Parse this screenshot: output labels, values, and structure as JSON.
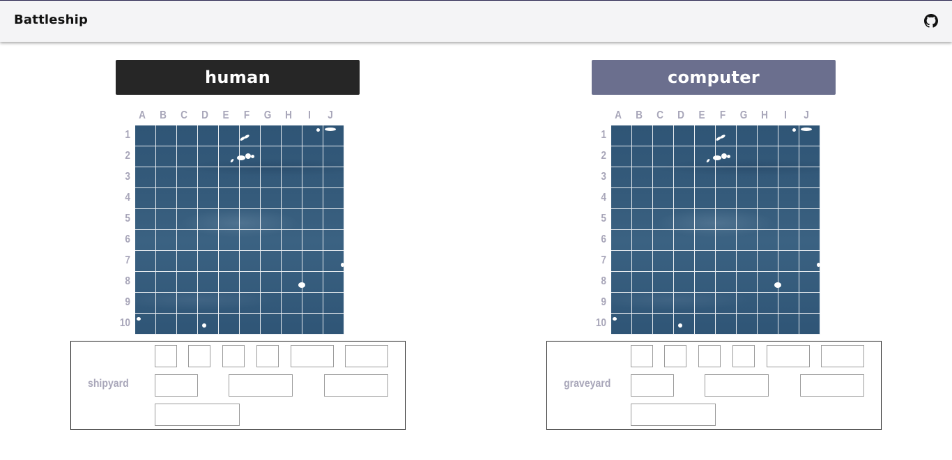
{
  "header": {
    "title": "Battleship",
    "github_icon": "github-icon"
  },
  "columns": [
    "A",
    "B",
    "C",
    "D",
    "E",
    "F",
    "G",
    "H",
    "I",
    "J"
  ],
  "rows": [
    "1",
    "2",
    "3",
    "4",
    "5",
    "6",
    "7",
    "8",
    "9",
    "10"
  ],
  "boards": [
    {
      "id": "human",
      "title": "human",
      "title_bg": "#262626",
      "dock_label": "shipyard"
    },
    {
      "id": "computer",
      "title": "computer",
      "title_bg": "#6b6f8e",
      "dock_label": "graveyard"
    }
  ],
  "colors": {
    "label": "#a8a6b9",
    "sea": "#345a7a",
    "grid_line": "#ffffff"
  }
}
